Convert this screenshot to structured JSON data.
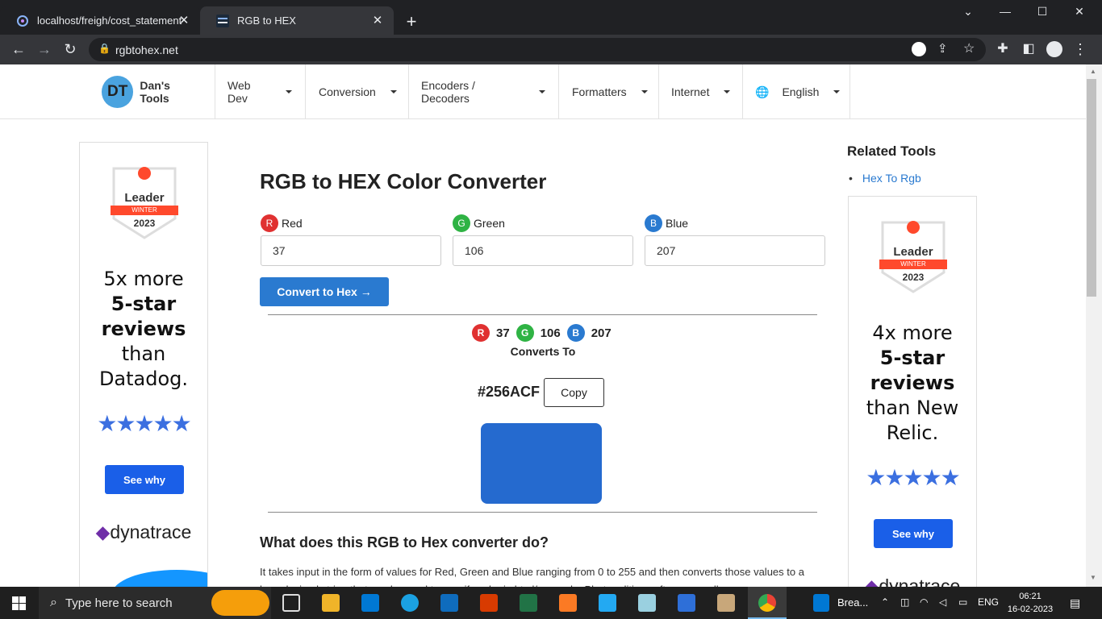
{
  "browser": {
    "tabs": [
      {
        "title": "localhost/freigh/cost_statement"
      },
      {
        "title": "RGB to HEX"
      }
    ],
    "new_tab": "+",
    "url": "rgbtohex.net"
  },
  "nav": {
    "logo_initials": "DT",
    "logo_text": "Dan's Tools",
    "items": [
      {
        "label": "Web Dev"
      },
      {
        "label": "Conversion"
      },
      {
        "label": "Encoders / Decoders"
      },
      {
        "label": "Formatters"
      },
      {
        "label": "Internet"
      },
      {
        "label": "English"
      }
    ]
  },
  "ad_left": {
    "badge_title": "Leader",
    "badge_season": "WINTER",
    "badge_year": "2023",
    "line1": "5x more",
    "bold1": "5-star",
    "bold2": "reviews",
    "line2": "than",
    "line3": "Datadog.",
    "stars": "★★★★★",
    "button": "See why",
    "brand": "dynatrace"
  },
  "ad_right": {
    "badge_title": "Leader",
    "badge_season": "WINTER",
    "badge_year": "2023",
    "line1": "4x more",
    "bold1": "5-star",
    "bold2": "reviews",
    "line2": "than New",
    "line3": "Relic.",
    "stars": "★★★★★",
    "button": "See why",
    "brand": "dynatrace"
  },
  "main": {
    "title": "RGB to HEX Color Converter",
    "red": {
      "letter": "R",
      "label": "Red",
      "value": "37"
    },
    "green": {
      "letter": "G",
      "label": "Green",
      "value": "106"
    },
    "blue": {
      "letter": "B",
      "label": "Blue",
      "value": "207"
    },
    "convert_button": "Convert to Hex →",
    "converts_to": "Converts To",
    "hex": "#256ACF",
    "copy_button": "Copy",
    "swatch_color": "#256ACF",
    "section_title": "What does this RGB to Hex converter do?",
    "description": "It takes input in the form of values for Red, Green and Blue ranging from 0 to 255 and then converts those values to a hexadecimal string that can be used to specify color in html/css code. Photo editing software usually"
  },
  "related": {
    "title": "Related Tools",
    "items": [
      {
        "label": "Hex To Rgb"
      }
    ]
  },
  "taskbar": {
    "search_placeholder": "Type here to search",
    "weather": "Brea...",
    "lang": "ENG",
    "time": "06:21",
    "date": "16-02-2023"
  },
  "colors": {
    "red": "#e03131",
    "green": "#2fb344",
    "blue": "#2a7ad0",
    "accent": "#2a7ad0"
  }
}
